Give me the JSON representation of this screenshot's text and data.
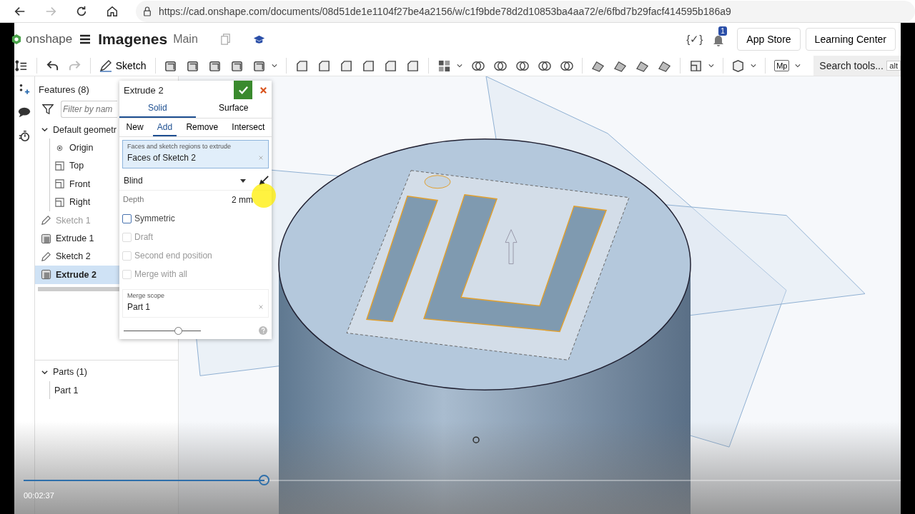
{
  "browser": {
    "url": "https://cad.onshape.com/documents/08d51de1e1104f27be4a2156/w/c1f9bde78d2d10853ba4aa72/e/6fbd7b29facf414595b186a9"
  },
  "header": {
    "logo": "onshape",
    "title": "Imagenes",
    "branch": "Main",
    "code_badge": "{✓}",
    "notification_count": "1",
    "buttons": [
      "App Store",
      "Learning Center"
    ]
  },
  "toolbar": {
    "sketch": "Sketch",
    "mp": "Mp",
    "search_placeholder": "Search tools...",
    "search_key": "alt"
  },
  "features": {
    "title": "Features (8)",
    "filter_placeholder": "Filter by nam",
    "tree": [
      {
        "label": "Default geometr",
        "kind": "folder",
        "expanded": true,
        "selected": false,
        "disabled": false,
        "children": [
          {
            "label": "Origin",
            "kind": "point",
            "selected": false,
            "disabled": false
          },
          {
            "label": "Top",
            "kind": "plane",
            "selected": false,
            "disabled": false
          },
          {
            "label": "Front",
            "kind": "plane",
            "selected": false,
            "disabled": false
          },
          {
            "label": "Right",
            "kind": "plane",
            "selected": false,
            "disabled": false
          }
        ]
      },
      {
        "label": "Sketch 1",
        "kind": "sketch",
        "selected": false,
        "disabled": true
      },
      {
        "label": "Extrude 1",
        "kind": "extrude",
        "selected": false,
        "disabled": false
      },
      {
        "label": "Sketch 2",
        "kind": "sketch",
        "selected": false,
        "disabled": false
      },
      {
        "label": "Extrude 2",
        "kind": "extrude",
        "selected": true,
        "disabled": false
      }
    ]
  },
  "parts": {
    "title": "Parts (1)",
    "expanded": true,
    "items": [
      "Part 1"
    ]
  },
  "dialog": {
    "title": "Extrude 2",
    "tabs": [
      {
        "label": "Solid",
        "selected": true
      },
      {
        "label": "Surface",
        "selected": false
      }
    ],
    "operations": [
      {
        "label": "New",
        "selected": false
      },
      {
        "label": "Add",
        "selected": true
      },
      {
        "label": "Remove",
        "selected": false
      },
      {
        "label": "Intersect",
        "selected": false
      }
    ],
    "selection": {
      "label": "Faces and sketch regions to extrude",
      "value": "Faces of Sketch 2"
    },
    "end_type": "Blind",
    "depth": {
      "label": "Depth",
      "value": "2 mm"
    },
    "options": [
      {
        "label": "Symmetric",
        "checked": false,
        "disabled": false
      },
      {
        "label": "Draft",
        "checked": false,
        "disabled": true
      },
      {
        "label": "Second end position",
        "checked": false,
        "disabled": true
      },
      {
        "label": "Merge with all",
        "checked": false,
        "disabled": true
      }
    ],
    "merge_scope": {
      "label": "Merge scope",
      "value": "Part 1"
    },
    "slider": {
      "level": 0.7
    }
  },
  "video": {
    "time": "00:02:37",
    "level": 0.275
  }
}
